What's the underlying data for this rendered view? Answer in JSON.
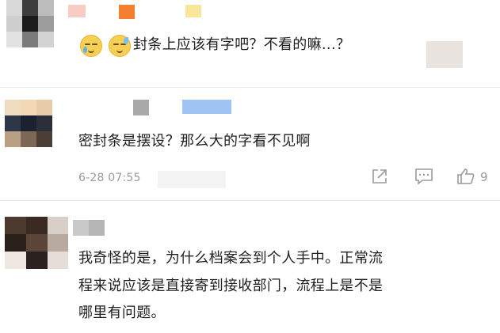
{
  "comments": [
    {
      "text": "封条上应该有字吧？不看的嘛...？",
      "emojis": [
        "sleepy-face-icon",
        "anxious-sweat-face-icon"
      ]
    },
    {
      "text": "密封条是摆设？那么大的字看不见啊",
      "time": "6-28 07:55",
      "like_count": "9"
    },
    {
      "lines": [
        "我奇怪的是，为什么档案会到个人手中。正常流",
        "程来说应该是直接寄到接收部门，流程上是不是",
        "哪里有问题。"
      ]
    }
  ],
  "icons": {
    "share": "share-icon",
    "comment": "comment-icon",
    "like": "thumbs-up-icon"
  },
  "colors": {
    "text": "#1f1f1f",
    "muted": "#9a9a9a",
    "divider": "#ececec"
  }
}
